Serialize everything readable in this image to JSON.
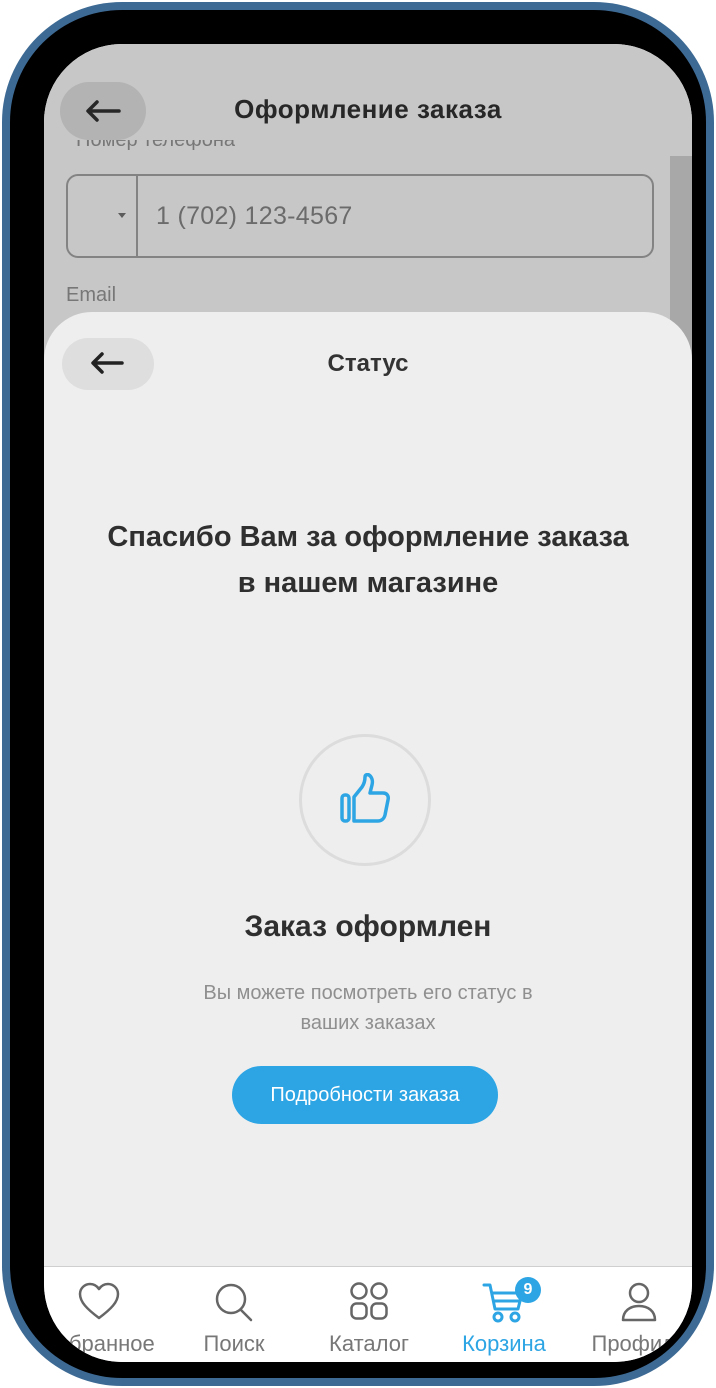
{
  "background_page": {
    "title": "Оформление заказа",
    "phone_label": "Номер телефона",
    "phone_placeholder": "1 (702) 123-4567",
    "email_label": "Email"
  },
  "sheet": {
    "title": "Статус",
    "thanks_line1": "Спасибо Вам за оформление заказа",
    "thanks_line2": "в нашем магазине",
    "done_title": "Заказ оформлен",
    "done_sub_line1": "Вы можете посмотреть его статус в",
    "done_sub_line2": "ваших заказах",
    "details_button": "Подробности заказа"
  },
  "tabbar": {
    "items": [
      {
        "label": "Избранное",
        "icon": "heart-icon"
      },
      {
        "label": "Поиск",
        "icon": "search-icon"
      },
      {
        "label": "Каталог",
        "icon": "catalog-grid-icon"
      },
      {
        "label": "Корзина",
        "icon": "cart-icon",
        "badge": "9",
        "active": true
      },
      {
        "label": "Профиль",
        "icon": "profile-icon"
      }
    ]
  },
  "colors": {
    "accent": "#2da5e4",
    "device_frame": "#3d6a94",
    "sheet_background": "#eeeeee"
  }
}
